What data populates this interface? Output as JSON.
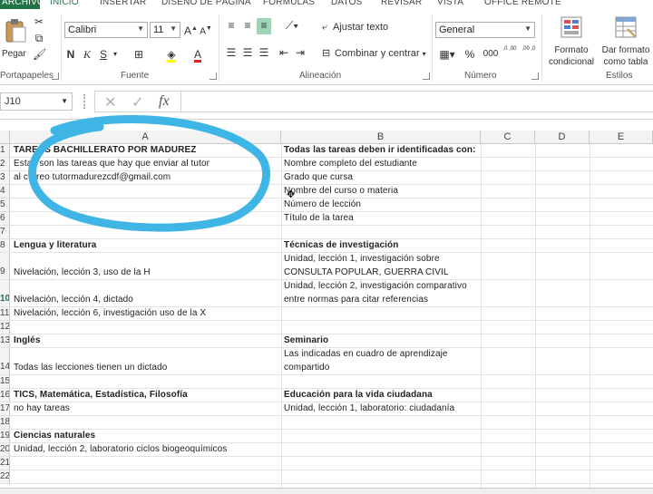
{
  "tabs": [
    "ARCHIVO",
    "INICIO",
    "INSERTAR",
    "DISEÑO DE PÁGINA",
    "FÓRMULAS",
    "DATOS",
    "REVISAR",
    "VISTA",
    "OFFICE REMOTE"
  ],
  "clipboard": {
    "paste_label": "Pegar",
    "group_label": "Portapapeles"
  },
  "font": {
    "name": "Calibri",
    "size": "11",
    "bold": "N",
    "italic": "K",
    "underline": "S",
    "group_label": "Fuente"
  },
  "alignment": {
    "wrap_label": "Ajustar texto",
    "merge_label": "Combinar y centrar",
    "group_label": "Alineación"
  },
  "number": {
    "format": "General",
    "percent": "%",
    "thousands": "000",
    "dec_inc": ",0 ,00",
    "dec_dec": ",00 ,0",
    "group_label": "Número"
  },
  "styles": {
    "conditional_line1": "Formato",
    "conditional_line2": "condicional",
    "table_line1": "Dar formato",
    "table_line2": "como tabla",
    "group_label": "Estilos"
  },
  "formula_bar": {
    "cell_ref": "J10",
    "fx": "fx",
    "cancel": "✕",
    "enter": "✓"
  },
  "columns": [
    "A",
    "B",
    "C",
    "D",
    "E"
  ],
  "rows": [
    {
      "n": "1",
      "a": "TAREAS BACHILLERATO POR MADUREZ",
      "a_bold": true,
      "b": "Todas las tareas deben ir identificadas con:",
      "b_bold": true
    },
    {
      "n": "2",
      "a": "Estas son las tareas que hay que enviar al tutor",
      "b": "Nombre completo del estudiante"
    },
    {
      "n": "3",
      "a": "al correo tutormadurezcdf@gmail.com",
      "b": "Grado que cursa"
    },
    {
      "n": "4",
      "a": "",
      "b": "Nombre del curso o materia"
    },
    {
      "n": "5",
      "a": "",
      "b": "Número de lección"
    },
    {
      "n": "6",
      "a": "",
      "b": "Título de la tarea"
    },
    {
      "n": "7",
      "a": "",
      "b": ""
    },
    {
      "n": "8",
      "a": "Lengua y literatura",
      "a_bold": true,
      "b": "Técnicas de investigación",
      "b_bold": true
    },
    {
      "n": "9",
      "a": "Nivelación, lección 3, uso de la H",
      "b": "Unidad, lección 1, investigación sobre",
      "b2": "CONSULTA POPULAR, GUERRA CIVIL",
      "tall": true
    },
    {
      "n": "10",
      "a": "Nivelación, lección 4, dictado",
      "b": "Unidad, lección 2, investigación comparativo",
      "b2": "entre normas para citar referencias",
      "tall": true,
      "selected": true
    },
    {
      "n": "11",
      "a": "Nivelación, lección 6, investigación uso de la X",
      "b": ""
    },
    {
      "n": "12",
      "a": "",
      "b": ""
    },
    {
      "n": "13",
      "a": "Inglés",
      "a_bold": true,
      "b": "Seminario",
      "b_bold": true
    },
    {
      "n": "14",
      "a": "Todas las lecciones tienen un dictado",
      "b": "Las indicadas en cuadro de aprendizaje",
      "b2": "compartido",
      "tall": true
    },
    {
      "n": "15",
      "a": "",
      "b": ""
    },
    {
      "n": "16",
      "a": "TICS, Matemática, Estadística, Filosofía",
      "a_bold": true,
      "b": "Educación para la vida ciudadana",
      "b_bold": true
    },
    {
      "n": "17",
      "a": "no hay tareas",
      "b": "Unidad, lección 1, laboratorio: ciudadanía"
    },
    {
      "n": "18",
      "a": "",
      "b": ""
    },
    {
      "n": "19",
      "a": "Ciencias naturales",
      "a_bold": true,
      "b": ""
    },
    {
      "n": "20",
      "a": "Unidad, lección 2, laboratorio ciclos biogeoquímicos",
      "b": ""
    },
    {
      "n": "21",
      "a": "",
      "b": ""
    },
    {
      "n": "22",
      "a": "",
      "b": ""
    }
  ],
  "colors": {
    "accent": "#217346",
    "annotation": "#3fb5e6"
  }
}
